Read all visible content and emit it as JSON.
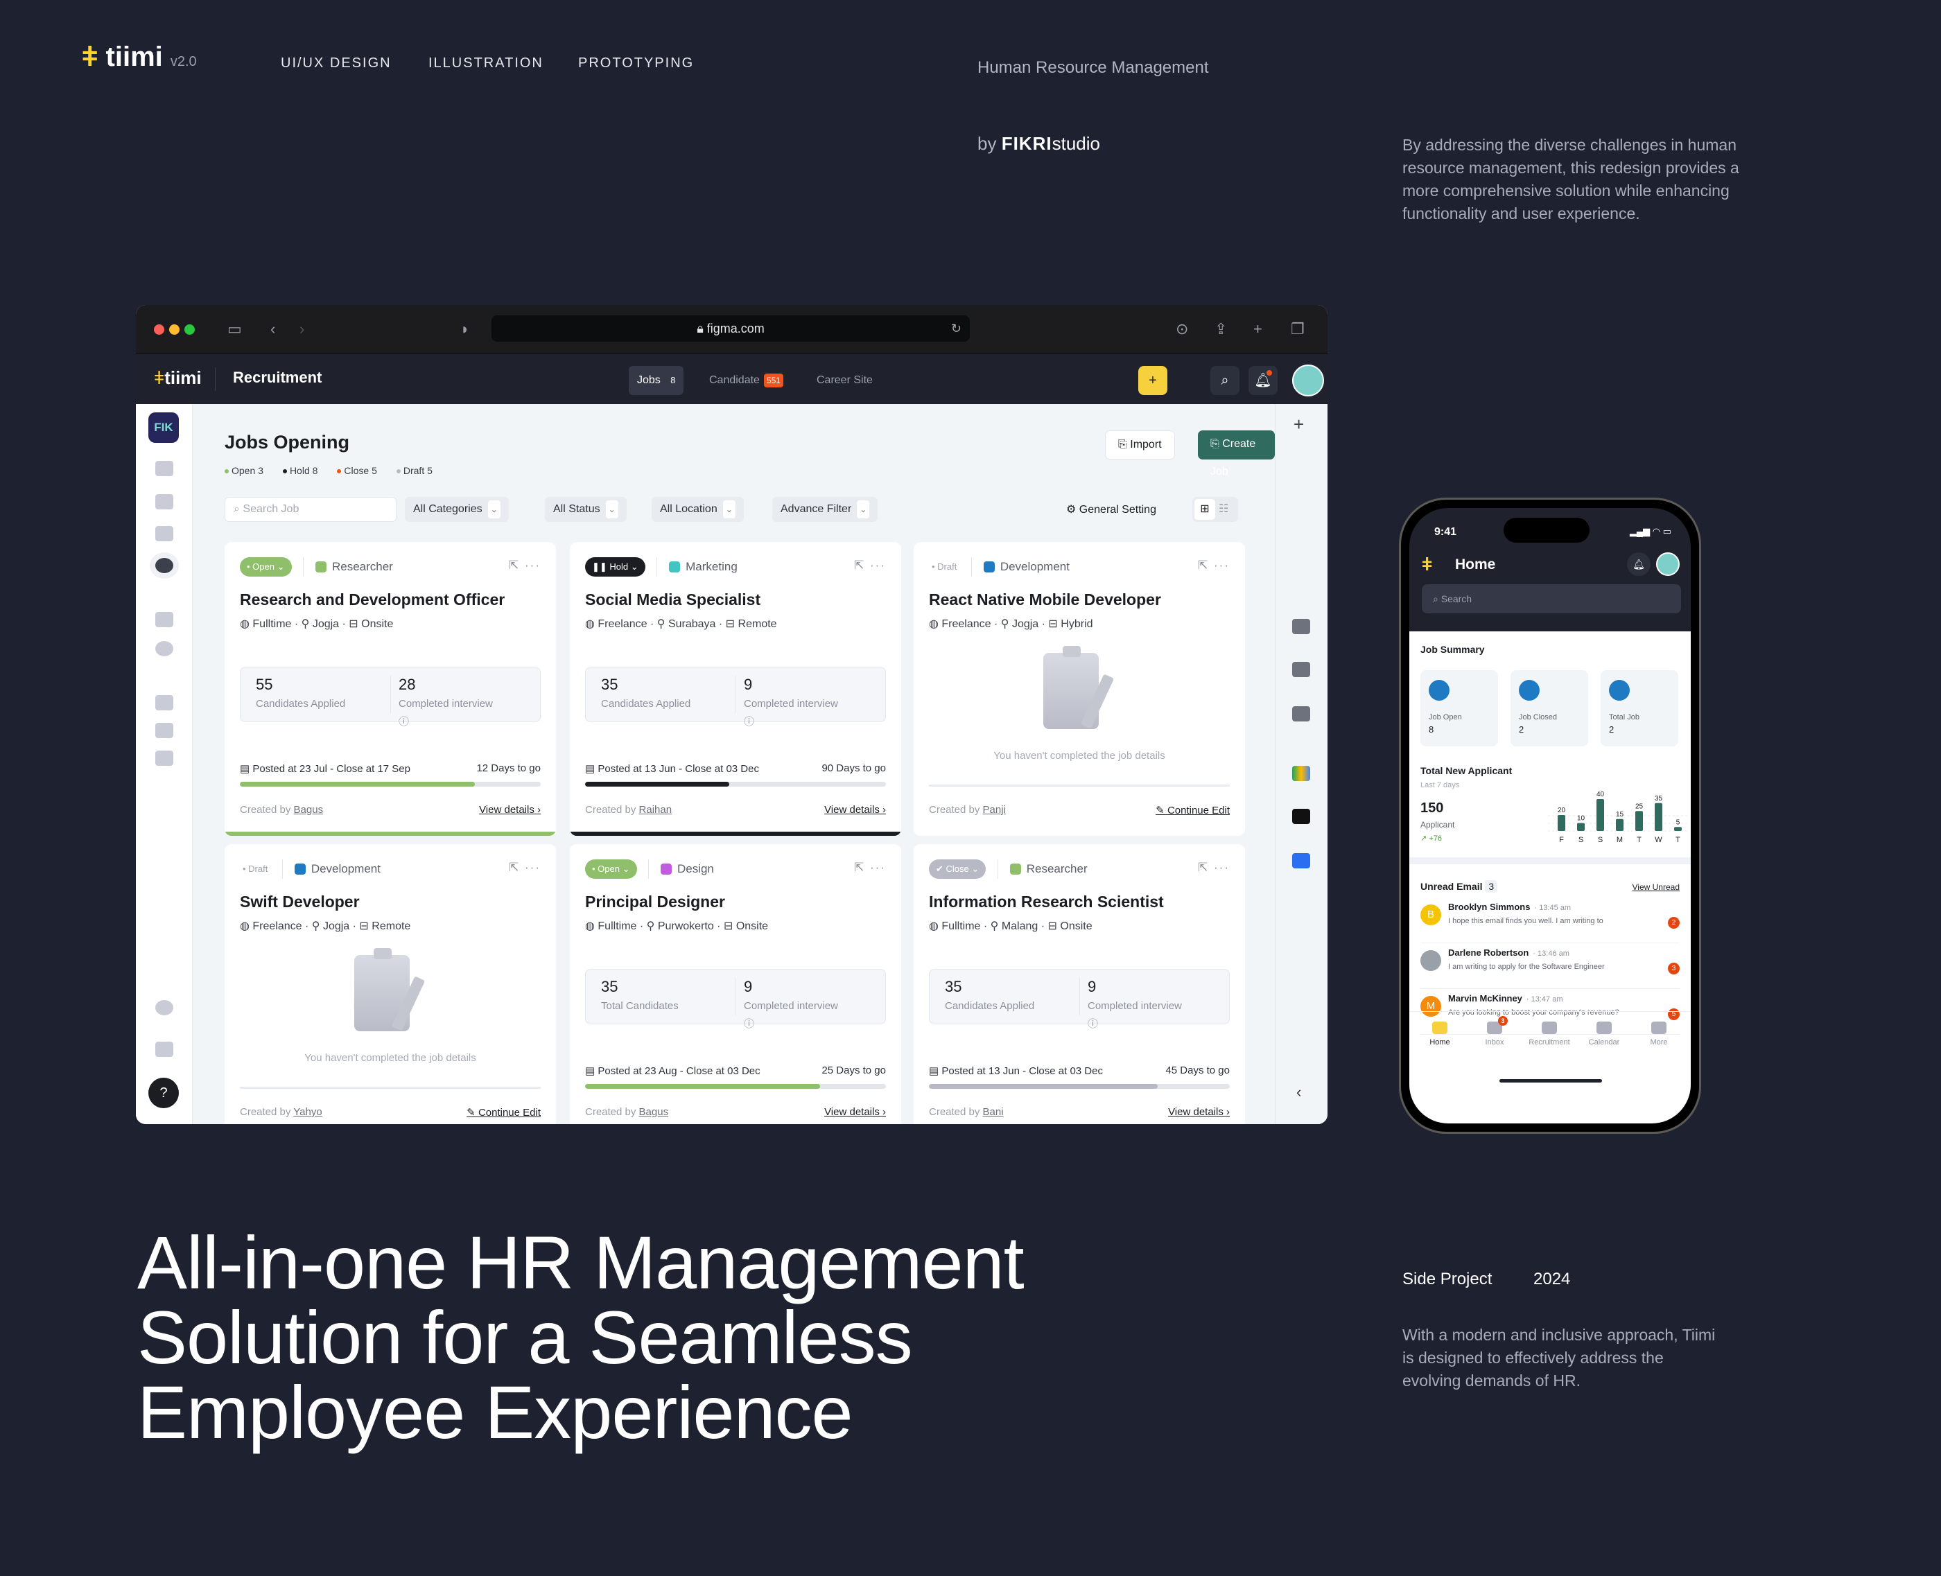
{
  "site": {
    "logo": "tiimi",
    "version": "v2.0",
    "nav": [
      "UI/UX DESIGN",
      "ILLUSTRATION",
      "PROTOTYPING"
    ],
    "subject": "Human Resource Management",
    "by": "by",
    "studio_logo": "fikri",
    "studio": "studio",
    "intro": "By addressing the diverse challenges in human resource management, this redesign provides a more comprehensive solution while enhancing functionality and user experience.",
    "headline": [
      "All-in-one HR Management",
      "Solution for a Seamless",
      "Employee Experience"
    ],
    "project_type": "Side Project",
    "year": "2024",
    "summary": "With a modern and inclusive approach, Tiimi is designed to effectively address the evolving demands of HR."
  },
  "browser": {
    "url": "figma.com"
  },
  "app": {
    "logo": "tiimi",
    "section": "Recruitment",
    "tabs": [
      {
        "label": "Jobs",
        "count": "8"
      },
      {
        "label": "Candidate",
        "count": "551"
      },
      {
        "label": "Career Site"
      }
    ],
    "workspace": "FIK",
    "page_title": "Jobs Opening",
    "legend": [
      {
        "label": "Open 3",
        "color": "#8fbf6b"
      },
      {
        "label": "Hold 8",
        "color": "#1b1d23"
      },
      {
        "label": "Close 5",
        "color": "#f0541a"
      },
      {
        "label": "Draft 5",
        "color": "#b7bac4"
      }
    ],
    "import_label": "Import",
    "create_label": "Create Job",
    "search_placeholder": "Search Job",
    "filters": [
      "All Categories",
      "All Status",
      "All Location",
      "Advance Filter"
    ],
    "general_setting": "General Setting",
    "accent": "#2f6b5f"
  },
  "jobs": [
    {
      "status": "Open",
      "category": "Researcher",
      "cat_color": "#8fbf6b",
      "title": "Research and Development Officer",
      "type": "Fulltime",
      "location": "Jogja",
      "mode": "Onsite",
      "stat1": "55",
      "stat1_label": "Candidates Applied",
      "stat2": "28",
      "stat2_label": "Completed interview",
      "posted": "Posted at 23 Jul - Close at 17 Sep",
      "days": "12 Days to go",
      "progress": 0.78,
      "bar_color": "#8fbf6b",
      "creator_label": "Created by",
      "creator": "Bagus",
      "action": "View details ›"
    },
    {
      "status": "Hold",
      "category": "Marketing",
      "cat_color": "#3fc6c0",
      "title": "Social Media Specialist",
      "type": "Freelance",
      "location": "Surabaya",
      "mode": "Remote",
      "stat1": "35",
      "stat1_label": "Candidates Applied",
      "stat2": "9",
      "stat2_label": "Completed interview",
      "posted": "Posted at 13 Jun - Close at 03 Dec",
      "days": "90 Days to go",
      "progress": 0.48,
      "bar_color": "#1b1d23",
      "creator_label": "Created by",
      "creator": "Raihan",
      "action": "View details ›"
    },
    {
      "status": "Draft",
      "category": "Development",
      "cat_color": "#1f7ac4",
      "title": "React Native Mobile Developer",
      "type": "Freelance",
      "location": "Jogja",
      "mode": "Hybrid",
      "empty": "You haven't completed the job details",
      "creator_label": "Created by",
      "creator": "Panji",
      "action": "Continue Edit"
    },
    {
      "status": "Draft",
      "category": "Development",
      "cat_color": "#1f7ac4",
      "title": "Swift Developer",
      "type": "Freelance",
      "location": "Jogja",
      "mode": "Remote",
      "empty": "You haven't completed the job details",
      "creator_label": "Created by",
      "creator": "Yahyo",
      "action": "Continue Edit"
    },
    {
      "status": "Open",
      "category": "Design",
      "cat_color": "#c15be0",
      "title": "Principal Designer",
      "type": "Fulltime",
      "location": "Purwokerto",
      "mode": "Onsite",
      "stat1": "35",
      "stat1_label": "Total Candidates",
      "stat2": "9",
      "stat2_label": "Completed interview",
      "posted": "Posted at 23 Aug - Close at 03 Dec",
      "days": "25 Days to go",
      "progress": 0.78,
      "bar_color": "#8fbf6b",
      "creator_label": "Created by",
      "creator": "Bagus",
      "action": "View details ›"
    },
    {
      "status": "Close",
      "category": "Researcher",
      "cat_color": "#8fbf6b",
      "title": "Information Research Scientist",
      "type": "Fulltime",
      "location": "Malang",
      "mode": "Onsite",
      "stat1": "35",
      "stat1_label": "Candidates Applied",
      "stat2": "9",
      "stat2_label": "Completed interview",
      "posted": "Posted at 13 Jun - Close at 03 Dec",
      "days": "45 Days to go",
      "progress": 0.76,
      "bar_color": "#b7bac4",
      "creator_label": "Created by",
      "creator": "Bani",
      "action": "View details ›"
    }
  ],
  "phone": {
    "time": "9:41",
    "title": "Home",
    "search_placeholder": "Search",
    "summary_title": "Job Summary",
    "tiles": [
      {
        "label": "Job Open",
        "value": "8"
      },
      {
        "label": "Job Closed",
        "value": "2"
      },
      {
        "label": "Total Job",
        "value": "2"
      }
    ],
    "applicant_title": "Total New Applicant",
    "applicant_sub": "Last 7 days",
    "applicant_total": "150",
    "applicant_label": "Applicant",
    "applicant_delta": "↗ +76",
    "chart_data": {
      "type": "bar",
      "categories": [
        "F",
        "S",
        "S",
        "M",
        "T",
        "W",
        "T"
      ],
      "values": [
        20,
        10,
        40,
        15,
        25,
        35,
        5
      ],
      "color": "#2f6b5f"
    },
    "email_title": "Unread Email",
    "email_count": "3",
    "view_unread": "View Unread",
    "emails": [
      {
        "initial": "B",
        "color": "#f5c400",
        "name": "Brooklyn Simmons",
        "time": "· 13:45 am",
        "preview": "I hope this email finds you well. I am writing to",
        "count": "2"
      },
      {
        "initial": "",
        "color": "#9aa0a8",
        "name": "Darlene Robertson",
        "time": "· 13:46 am",
        "preview": "I am writing to apply for the Software Engineer",
        "count": "3"
      },
      {
        "initial": "M",
        "color": "#f58a0c",
        "name": "Marvin McKinney",
        "time": "· 13:47 am",
        "preview": "Are you looking to boost your company's revenue?",
        "count": "5"
      }
    ],
    "tabs": [
      "Home",
      "Inbox",
      "Recruitment",
      "Calendar",
      "More"
    ],
    "inbox_badge": "3"
  }
}
